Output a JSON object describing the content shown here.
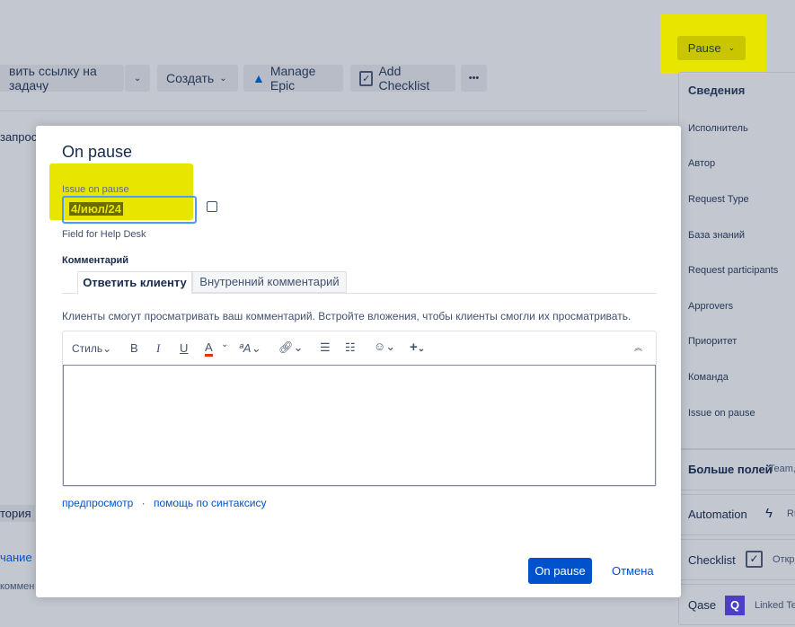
{
  "toolbar": {
    "link_issue": "вить ссылку на задачу",
    "create": "Создать",
    "manage_epic": "Manage Epic",
    "add_checklist": "Add Checklist",
    "more": "•••"
  },
  "pause_button": "Pause",
  "background": {
    "request_fragment": "запрос",
    "history_fragment": "тория",
    "tab_fragment": "чание",
    "comment_fragment": "коммен"
  },
  "sidebar": {
    "title": "Сведения",
    "fields": [
      "Исполнитель",
      "Автор",
      "Request Type",
      "База знаний",
      "Request participants",
      "Approvers",
      "Приоритет",
      "Команда",
      "Issue on pause"
    ],
    "more_fields": "Больше полей",
    "more_fields_hint": "Team,",
    "automation": "Automation",
    "automation_hint": "Ru",
    "checklist": "Checklist",
    "checklist_hint": "Откр",
    "qase": "Qase",
    "qase_hint": "Linked Tes"
  },
  "modal": {
    "title": "On pause",
    "date_label": "Issue on pause",
    "date_value": "4/июл/24",
    "date_help": "Field for Help Desk",
    "comment_label": "Комментарий",
    "tabs": [
      "Ответить клиенту",
      "Внутренний комментарий"
    ],
    "info": "Клиенты смогут просматривать ваш комментарий. Встройте вложения, чтобы клиенты смогли их просматривать.",
    "style": "Стиль",
    "preview": "предпросмотр",
    "separator": "·",
    "syntax_help": "помощь по синтаксису",
    "submit": "On pause",
    "cancel": "Отмена"
  },
  "colors": {
    "highlight": "#e8e500",
    "primary": "#0052cc"
  }
}
